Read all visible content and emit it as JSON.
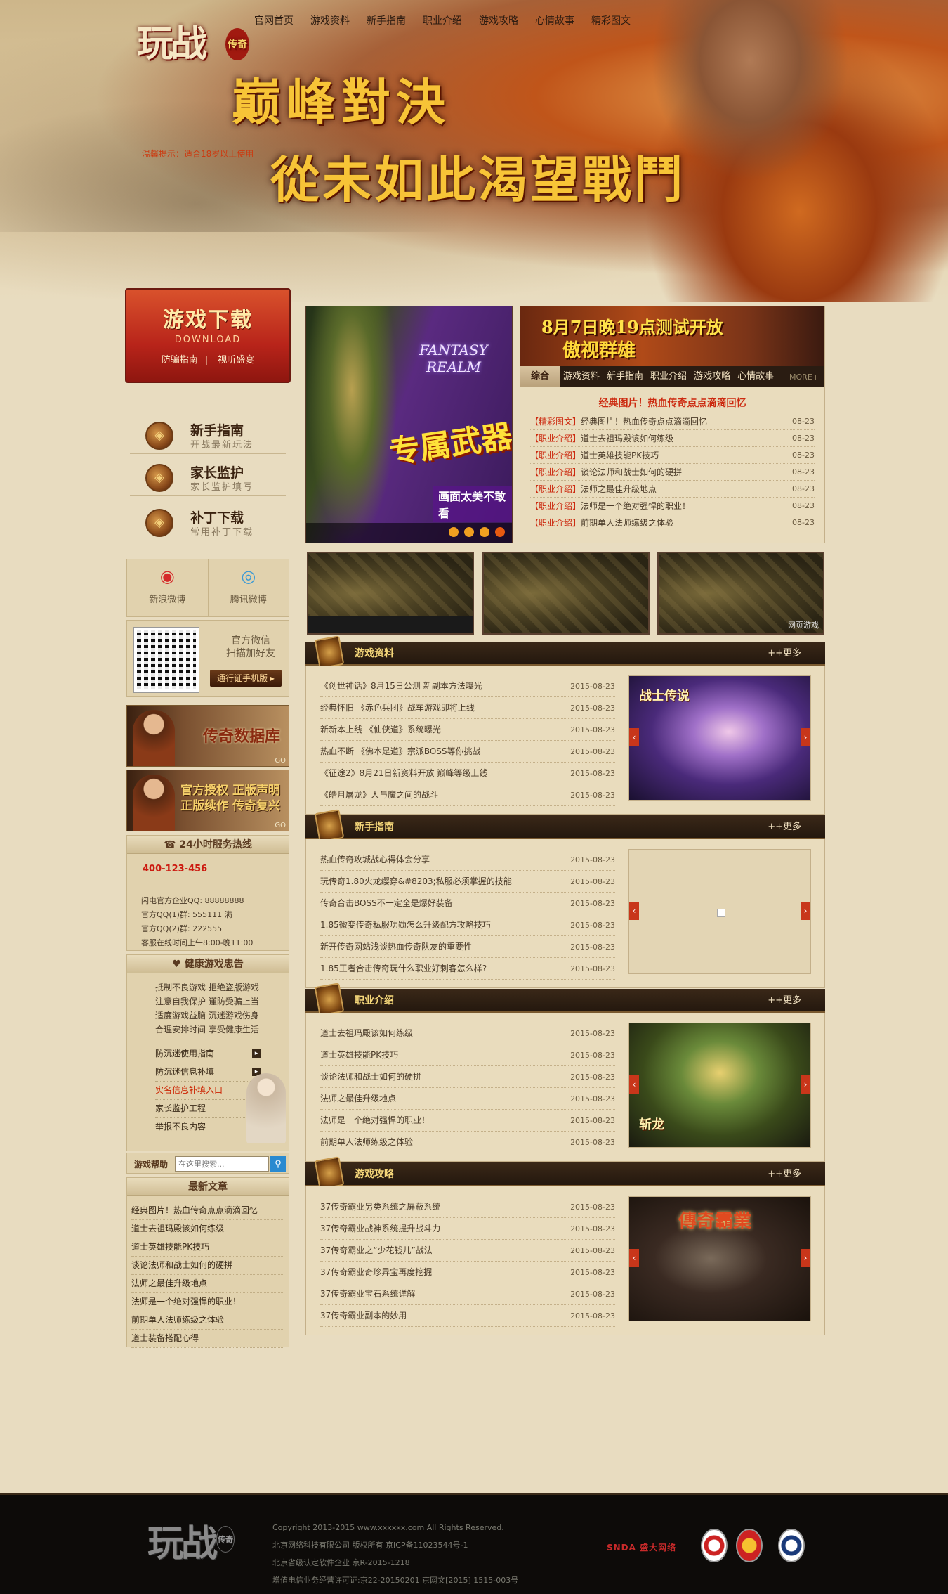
{
  "nav": [
    "官网首页",
    "游戏资料",
    "新手指南",
    "职业介绍",
    "游戏攻略",
    "心情故事",
    "精彩图文"
  ],
  "logo": {
    "text": "玩战",
    "badge": "传奇"
  },
  "notice": "温馨提示：适合18岁以上使用",
  "slogan": {
    "line1": "巅峰對決",
    "line2": "從未如此渴望戰鬥"
  },
  "download": {
    "title": "游戏下载",
    "sub": "DOWNLOAD",
    "links": [
      "防骗指南",
      "视听盛宴"
    ]
  },
  "guides": [
    {
      "title": "新手指南",
      "sub": "开战最新玩法",
      "icon": "book-icon"
    },
    {
      "title": "家长监护",
      "sub": "家长监护填写",
      "icon": "family-icon"
    },
    {
      "title": "补丁下载",
      "sub": "常用补丁下载",
      "icon": "patch-icon"
    }
  ],
  "weibo": [
    {
      "label": "新浪微博",
      "icon": "sina-weibo-icon"
    },
    {
      "label": "腾讯微博",
      "icon": "tencent-weibo-icon"
    }
  ],
  "wechat": {
    "line1": "官方微信",
    "line2": "扫描加好友",
    "button": "通行证手机版 ▸"
  },
  "banners": [
    {
      "text": "传奇数据库",
      "go": "GO"
    },
    {
      "text1": "官方授权 正版声明",
      "text2": "正版续作 传奇复兴",
      "go": "GO"
    }
  ],
  "hotline": {
    "title": "24小时服务热线",
    "tel": "400-123-456",
    "lines": [
      "闪电官方企业QQ: 88888888",
      "官方QQ(1)群: 555111 满",
      "官方QQ(2)群: 222555",
      "客服在线时间上午8:00-晚11:00"
    ]
  },
  "health": {
    "title": "健康游戏忠告",
    "text": [
      "抵制不良游戏 拒绝盗版游戏",
      "注意自我保护 谨防受骗上当",
      "适度游戏益脑 沉迷游戏伤身",
      "合理安排时间 享受健康生活"
    ],
    "links": [
      "防沉迷使用指南",
      "防沉迷信息补填",
      "实名信息补填入口",
      "家长监护工程",
      "举报不良内容"
    ]
  },
  "search": {
    "label": "游戏帮助",
    "placeholder": "在这里搜索..."
  },
  "latest": {
    "title": "最新文章",
    "items": [
      "经典图片！热血传奇点点滴滴回忆",
      "道士去祖玛殿该如何练级",
      "道士英雄技能PK技巧",
      "谈论法师和战士如何的硬拼",
      "法师之最佳升级地点",
      "法师是一个绝对强悍的职业！",
      "前期单人法师练级之体验",
      "道士装备搭配心得"
    ]
  },
  "carousel": {
    "title": "FANTASY REALM",
    "caption": "专属武器",
    "sub": "画面太美不敢看",
    "dots": 4
  },
  "newsbanner": {
    "line1": "8月7日晚19点测试开放",
    "line2": "傲视群雄"
  },
  "tabs": [
    "综合",
    "游戏资料",
    "新手指南",
    "职业介绍",
    "游戏攻略",
    "心情故事"
  ],
  "tabs_more": "MORE+",
  "headline": "经典图片！热血传奇点点滴滴回忆",
  "news": [
    {
      "cat": "【精彩图文】",
      "title": "经典图片！热血传奇点点滴滴回忆",
      "date": "08-23"
    },
    {
      "cat": "【职业介绍】",
      "title": "道士去祖玛殿该如何练级",
      "date": "08-23"
    },
    {
      "cat": "【职业介绍】",
      "title": "道士英雄技能PK技巧",
      "date": "08-23"
    },
    {
      "cat": "【职业介绍】",
      "title": "谈论法师和战士如何的硬拼",
      "date": "08-23"
    },
    {
      "cat": "【职业介绍】",
      "title": "法师之最佳升级地点",
      "date": "08-23"
    },
    {
      "cat": "【职业介绍】",
      "title": "法师是一个绝对强悍的职业！",
      "date": "08-23"
    },
    {
      "cat": "【职业介绍】",
      "title": "前期单人法师练级之体验",
      "date": "08-23"
    }
  ],
  "screenshots_watermark": "网页游戏",
  "sections": [
    {
      "title": "游戏资料",
      "more": "++更多",
      "pic_text": "战士传说",
      "items": [
        {
          "t": "《创世神话》8月15日公测 新副本方法曝光",
          "d": "2015-08-23"
        },
        {
          "t": "经典怀旧 《赤色兵团》战车游戏即将上线",
          "d": "2015-08-23"
        },
        {
          "t": "新新本上线 《仙侠道》系统曝光",
          "d": "2015-08-23"
        },
        {
          "t": "热血不断 《佛本是道》宗派BOSS等你挑战",
          "d": "2015-08-23"
        },
        {
          "t": "《征途2》8月21日新资料开放 巅峰等级上线",
          "d": "2015-08-23"
        },
        {
          "t": "《皓月屠龙》人与魔之间的战斗",
          "d": "2015-08-23"
        }
      ]
    },
    {
      "title": "新手指南",
      "more": "++更多",
      "pic_text": "",
      "items": [
        {
          "t": "热血传奇攻城战心得体会分享",
          "d": "2015-08-23"
        },
        {
          "t": "玩传奇1.80火龙缨穿&#8203;私服必须掌握的技能",
          "d": "2015-08-23"
        },
        {
          "t": "传奇合击BOSS不一定全是爆好装备",
          "d": "2015-08-23"
        },
        {
          "t": "1.85微变传奇私服功勋怎么升级配方攻略技巧",
          "d": "2015-08-23"
        },
        {
          "t": "新开传奇网站浅谈热血传奇队友的重要性",
          "d": "2015-08-23"
        },
        {
          "t": "1.85王者合击传奇玩什么职业好刺客怎么样?",
          "d": "2015-08-23"
        }
      ]
    },
    {
      "title": "职业介绍",
      "more": "++更多",
      "pic_text": "斩龙",
      "items": [
        {
          "t": "道士去祖玛殿该如何练级",
          "d": "2015-08-23"
        },
        {
          "t": "道士英雄技能PK技巧",
          "d": "2015-08-23"
        },
        {
          "t": "谈论法师和战士如何的硬拼",
          "d": "2015-08-23"
        },
        {
          "t": "法师之最佳升级地点",
          "d": "2015-08-23"
        },
        {
          "t": "法师是一个绝对强悍的职业！",
          "d": "2015-08-23"
        },
        {
          "t": "前期单人法师练级之体验",
          "d": "2015-08-23"
        }
      ]
    },
    {
      "title": "游戏攻略",
      "more": "++更多",
      "pic_text": "傳奇霸業",
      "items": [
        {
          "t": "37传奇霸业另类系统之屏蔽系统",
          "d": "2015-08-23"
        },
        {
          "t": "37传奇霸业战神系统提升战斗力",
          "d": "2015-08-23"
        },
        {
          "t": "37传奇霸业之“少花钱儿”战法",
          "d": "2015-08-23"
        },
        {
          "t": "37传奇霸业奇珍异宝再度挖掘",
          "d": "2015-08-23"
        },
        {
          "t": "37传奇霸业宝石系统详解",
          "d": "2015-08-23"
        },
        {
          "t": "37传奇霸业副本的妙用",
          "d": "2015-08-23"
        }
      ]
    }
  ],
  "footer": {
    "logo": "玩战",
    "badge": "传奇",
    "lines": [
      "Copyright 2013-2015 www.xxxxxx.com All Rights Reserved.",
      "北京网络科技有限公司 版权所有 京ICP备11023544号-1",
      "北京省级认定软件企业 京R-2015-1218",
      "增值电信业务经营许可证:京22-20150201 京网文[2015] 1515-003号"
    ],
    "snda": "SNDA 盛大网络"
  }
}
